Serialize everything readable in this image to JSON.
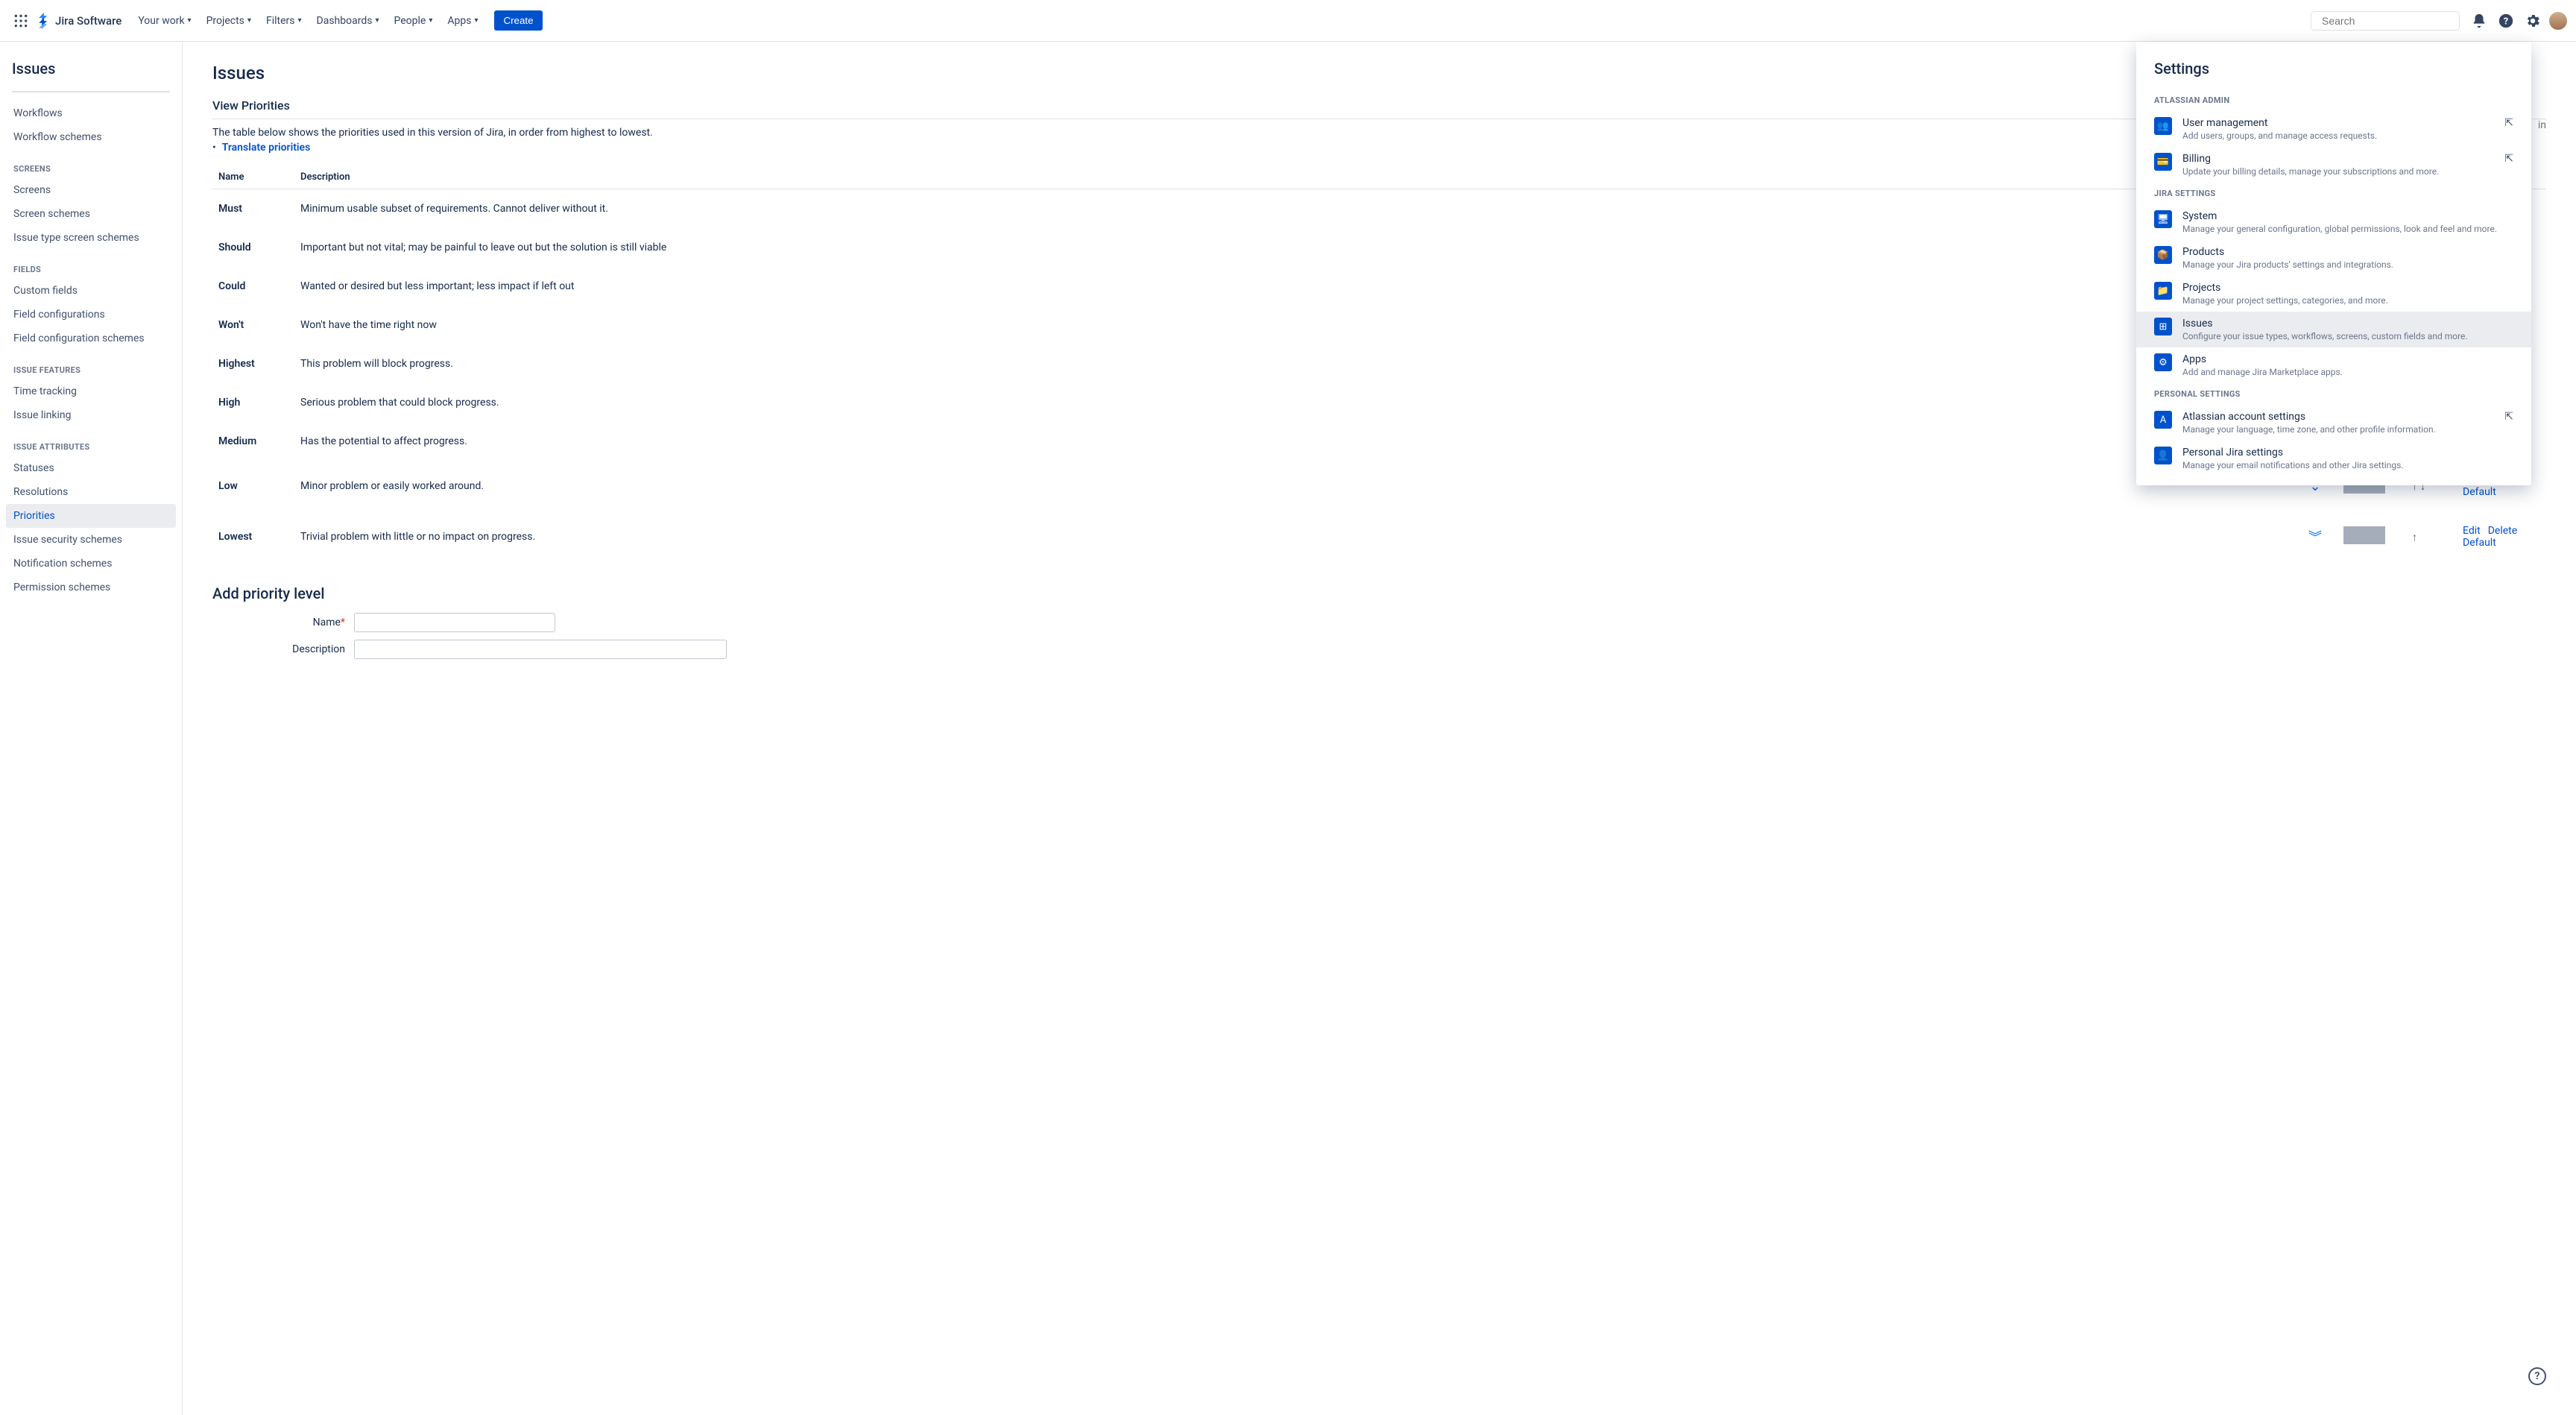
{
  "topnav": {
    "logo_text": "Jira Software",
    "items": [
      "Your work",
      "Projects",
      "Filters",
      "Dashboards",
      "People",
      "Apps"
    ],
    "create": "Create",
    "search_placeholder": "Search"
  },
  "sidebar": {
    "title": "Issues",
    "top_items": [
      "Workflows",
      "Workflow schemes"
    ],
    "groups": [
      {
        "label": "SCREENS",
        "items": [
          "Screens",
          "Screen schemes",
          "Issue type screen schemes"
        ]
      },
      {
        "label": "FIELDS",
        "items": [
          "Custom fields",
          "Field configurations",
          "Field configuration schemes"
        ]
      },
      {
        "label": "ISSUE FEATURES",
        "items": [
          "Time tracking",
          "Issue linking"
        ]
      },
      {
        "label": "ISSUE ATTRIBUTES",
        "items": [
          "Statuses",
          "Resolutions",
          "Priorities",
          "Issue security schemes",
          "Notification schemes",
          "Permission schemes"
        ]
      }
    ],
    "active": "Priorities"
  },
  "main": {
    "title": "Issues",
    "truncated_word": "in",
    "section": "View Priorities",
    "intro": "The table below shows the priorities used in this version of Jira, in order from highest to lowest.",
    "translate": "Translate priorities",
    "columns": {
      "name": "Name",
      "desc": "Description"
    },
    "rows": [
      {
        "name": "Must",
        "desc": "Minimum usable subset of requirements. Cannot deliver without it."
      },
      {
        "name": "Should",
        "desc": "Important but not vital; may be painful to leave out but the solution is still viable"
      },
      {
        "name": "Could",
        "desc": "Wanted or desired but less important; less impact if left out"
      },
      {
        "name": "Won't",
        "desc": "Won't have the time right now"
      },
      {
        "name": "Highest",
        "desc": "This problem will block progress."
      },
      {
        "name": "High",
        "desc": "Serious problem that could block progress."
      },
      {
        "name": "Medium",
        "desc": "Has the potential to affect progress."
      },
      {
        "name": "Low",
        "desc": "Minor problem or easily worked around.",
        "icon": "single-down",
        "up": true,
        "down": true
      },
      {
        "name": "Lowest",
        "desc": "Trivial problem with little or no impact on progress.",
        "icon": "double-down",
        "up": true,
        "down": false
      }
    ],
    "ops": {
      "edit": "Edit",
      "delete": "Delete",
      "default": "Default"
    },
    "add": {
      "title": "Add priority level",
      "name_label": "Name",
      "desc_label": "Description"
    }
  },
  "settings": {
    "title": "Settings",
    "groups": [
      {
        "label": "ATLASSIAN ADMIN",
        "items": [
          {
            "icon": "users",
            "title": "User management",
            "desc": "Add users, groups, and manage access requests.",
            "ext": true
          },
          {
            "icon": "billing",
            "title": "Billing",
            "desc": "Update your billing details, manage your subscriptions and more.",
            "ext": true
          }
        ]
      },
      {
        "label": "JIRA SETTINGS",
        "items": [
          {
            "icon": "system",
            "title": "System",
            "desc": "Manage your general configuration, global permissions, look and feel and more."
          },
          {
            "icon": "products",
            "title": "Products",
            "desc": "Manage your Jira products' settings and integrations."
          },
          {
            "icon": "projects",
            "title": "Projects",
            "desc": "Manage your project settings, categories, and more."
          },
          {
            "icon": "issues",
            "title": "Issues",
            "desc": "Configure your issue types, workflows, screens, custom fields and more.",
            "active": true
          },
          {
            "icon": "apps",
            "title": "Apps",
            "desc": "Add and manage Jira Marketplace apps."
          }
        ]
      },
      {
        "label": "PERSONAL SETTINGS",
        "items": [
          {
            "icon": "account",
            "title": "Atlassian account settings",
            "desc": "Manage your language, time zone, and other profile information.",
            "ext": true
          },
          {
            "icon": "personal",
            "title": "Personal Jira settings",
            "desc": "Manage your email notifications and other Jira settings."
          }
        ]
      }
    ]
  }
}
